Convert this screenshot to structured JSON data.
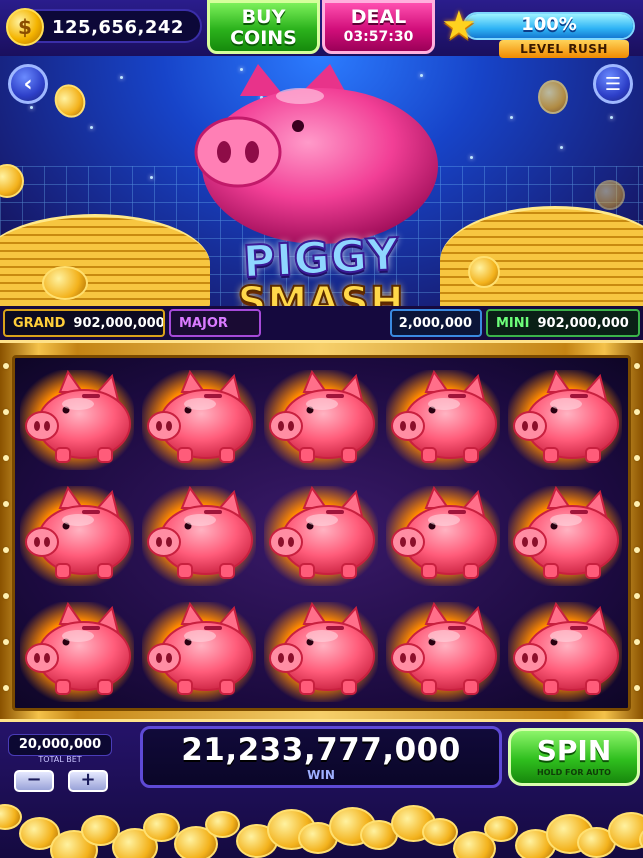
{
  "header": {
    "coin_balance": "125,656,242",
    "coin_icon": "coin-icon",
    "buy_coins_line1": "BUY",
    "buy_coins_line2": "COINS",
    "deal_title": "DEAL",
    "deal_timer": "03:57:30",
    "level_percent": "100%",
    "level_progress": 1.0,
    "level_tag": "LEVEL RUSH",
    "star_icon": "star-icon"
  },
  "nav": {
    "back_icon": "back-arrow-icon",
    "menu_icon": "hamburger-menu-icon"
  },
  "game": {
    "title_line1": "PIGGY",
    "title_line2": "SMASH"
  },
  "jackpots": [
    {
      "label": "GRAND",
      "value": "902,000,000"
    },
    {
      "label": "MAJOR",
      "value": ""
    },
    {
      "label": "",
      "value": "2,000,000"
    },
    {
      "label": "MINI",
      "value": "902,000,000"
    }
  ],
  "reels": {
    "rows": 3,
    "columns": 5,
    "symbol": "piggy-bank"
  },
  "footer": {
    "bet_amount": "20,000,000",
    "bet_label": "TOTAL BET",
    "minus_label": "−",
    "plus_label": "+",
    "win_amount": "21,233,777,000",
    "win_label": "WIN",
    "spin_label": "SPIN",
    "spin_sub": "HOLD FOR AUTO"
  },
  "colors": {
    "pig_pink": "#ff5c7a",
    "gold": "#f4c24a",
    "spin_green": "#2fbf1e",
    "deal_pink": "#d10e7a"
  }
}
